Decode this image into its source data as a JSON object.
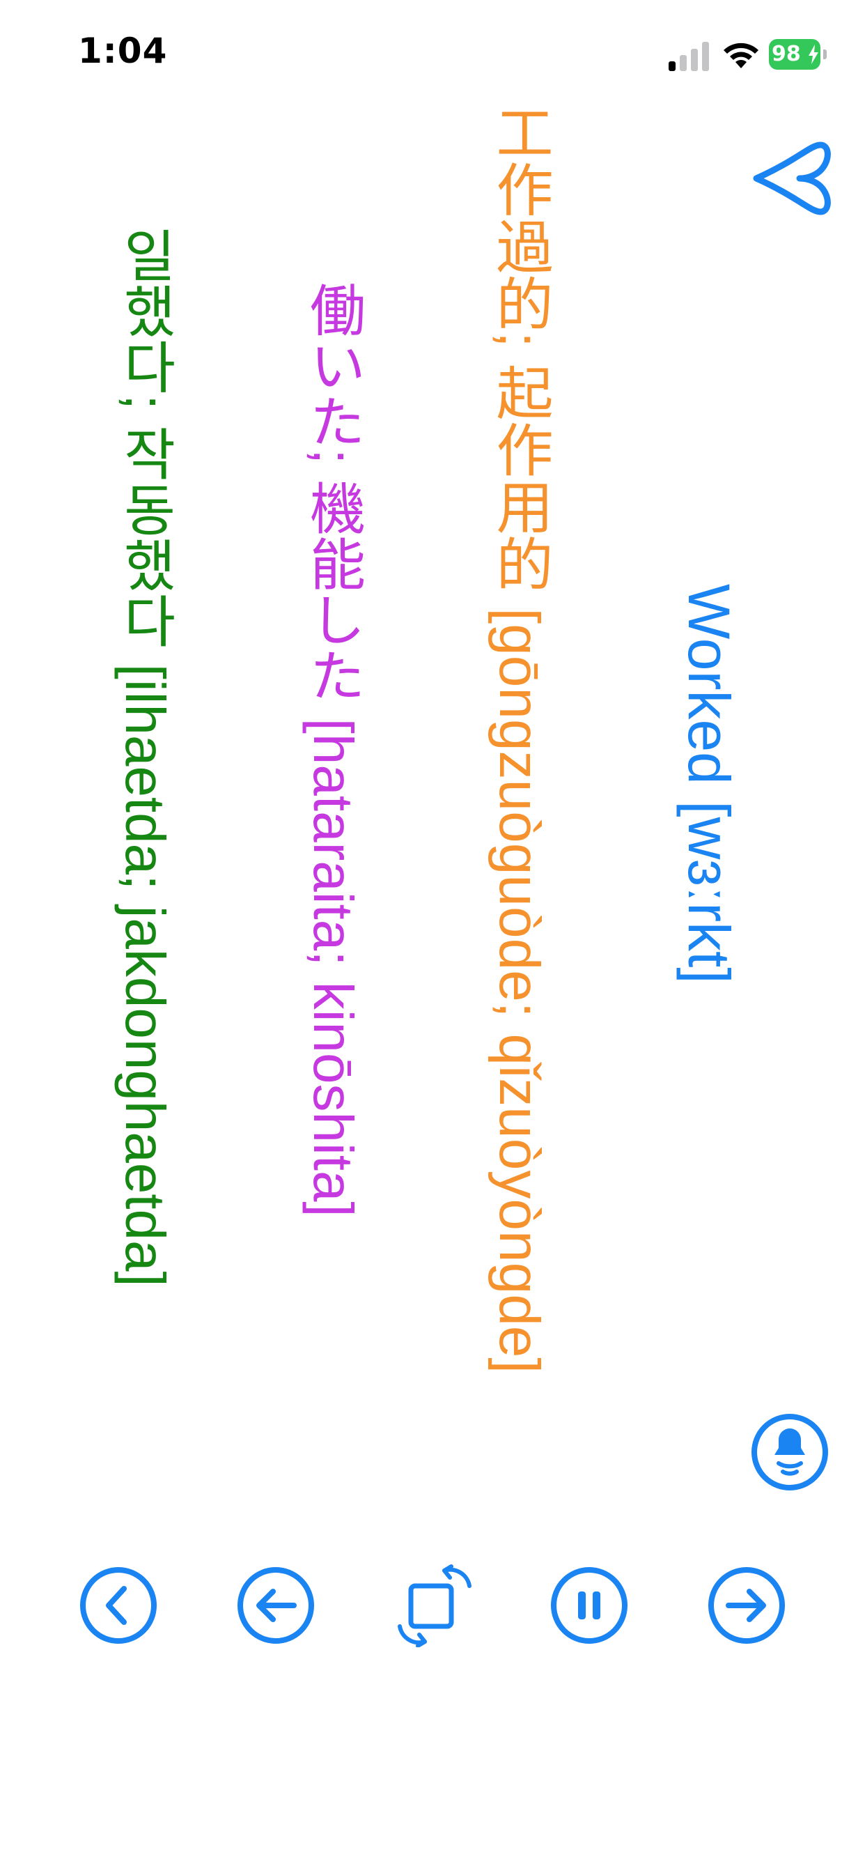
{
  "status_bar": {
    "time": "1:04",
    "battery_level": "98",
    "signal_icon": "cellular-signal-icon",
    "wifi_icon": "wifi-icon",
    "battery_icon": "battery-charging-icon"
  },
  "card": {
    "english": "Worked [wɜːrkt]",
    "chinese": "工作過的; 起作用的 [gōngzuòguòde; qǐzuòyòngde]",
    "japanese": "働いた; 機能した [hataraita; kinōshita]",
    "korean": "일했다; 작동했다 [ilhaetda; jakdonghaetda]"
  },
  "actions": {
    "favorite_icon": "heart-outline-icon",
    "speak_icon": "speaker-voice-icon"
  },
  "controls": {
    "back_icon": "chevron-left-circle-icon",
    "previous_icon": "arrow-left-circle-icon",
    "rotate_icon": "rotate-orientation-icon",
    "pause_icon": "pause-circle-icon",
    "next_icon": "arrow-right-circle-icon"
  },
  "colors": {
    "accent": "#1a84f2",
    "english": "#1a84f2",
    "chinese": "#f5922e",
    "japanese": "#c638e0",
    "korean": "#158712",
    "battery": "#34c759"
  }
}
